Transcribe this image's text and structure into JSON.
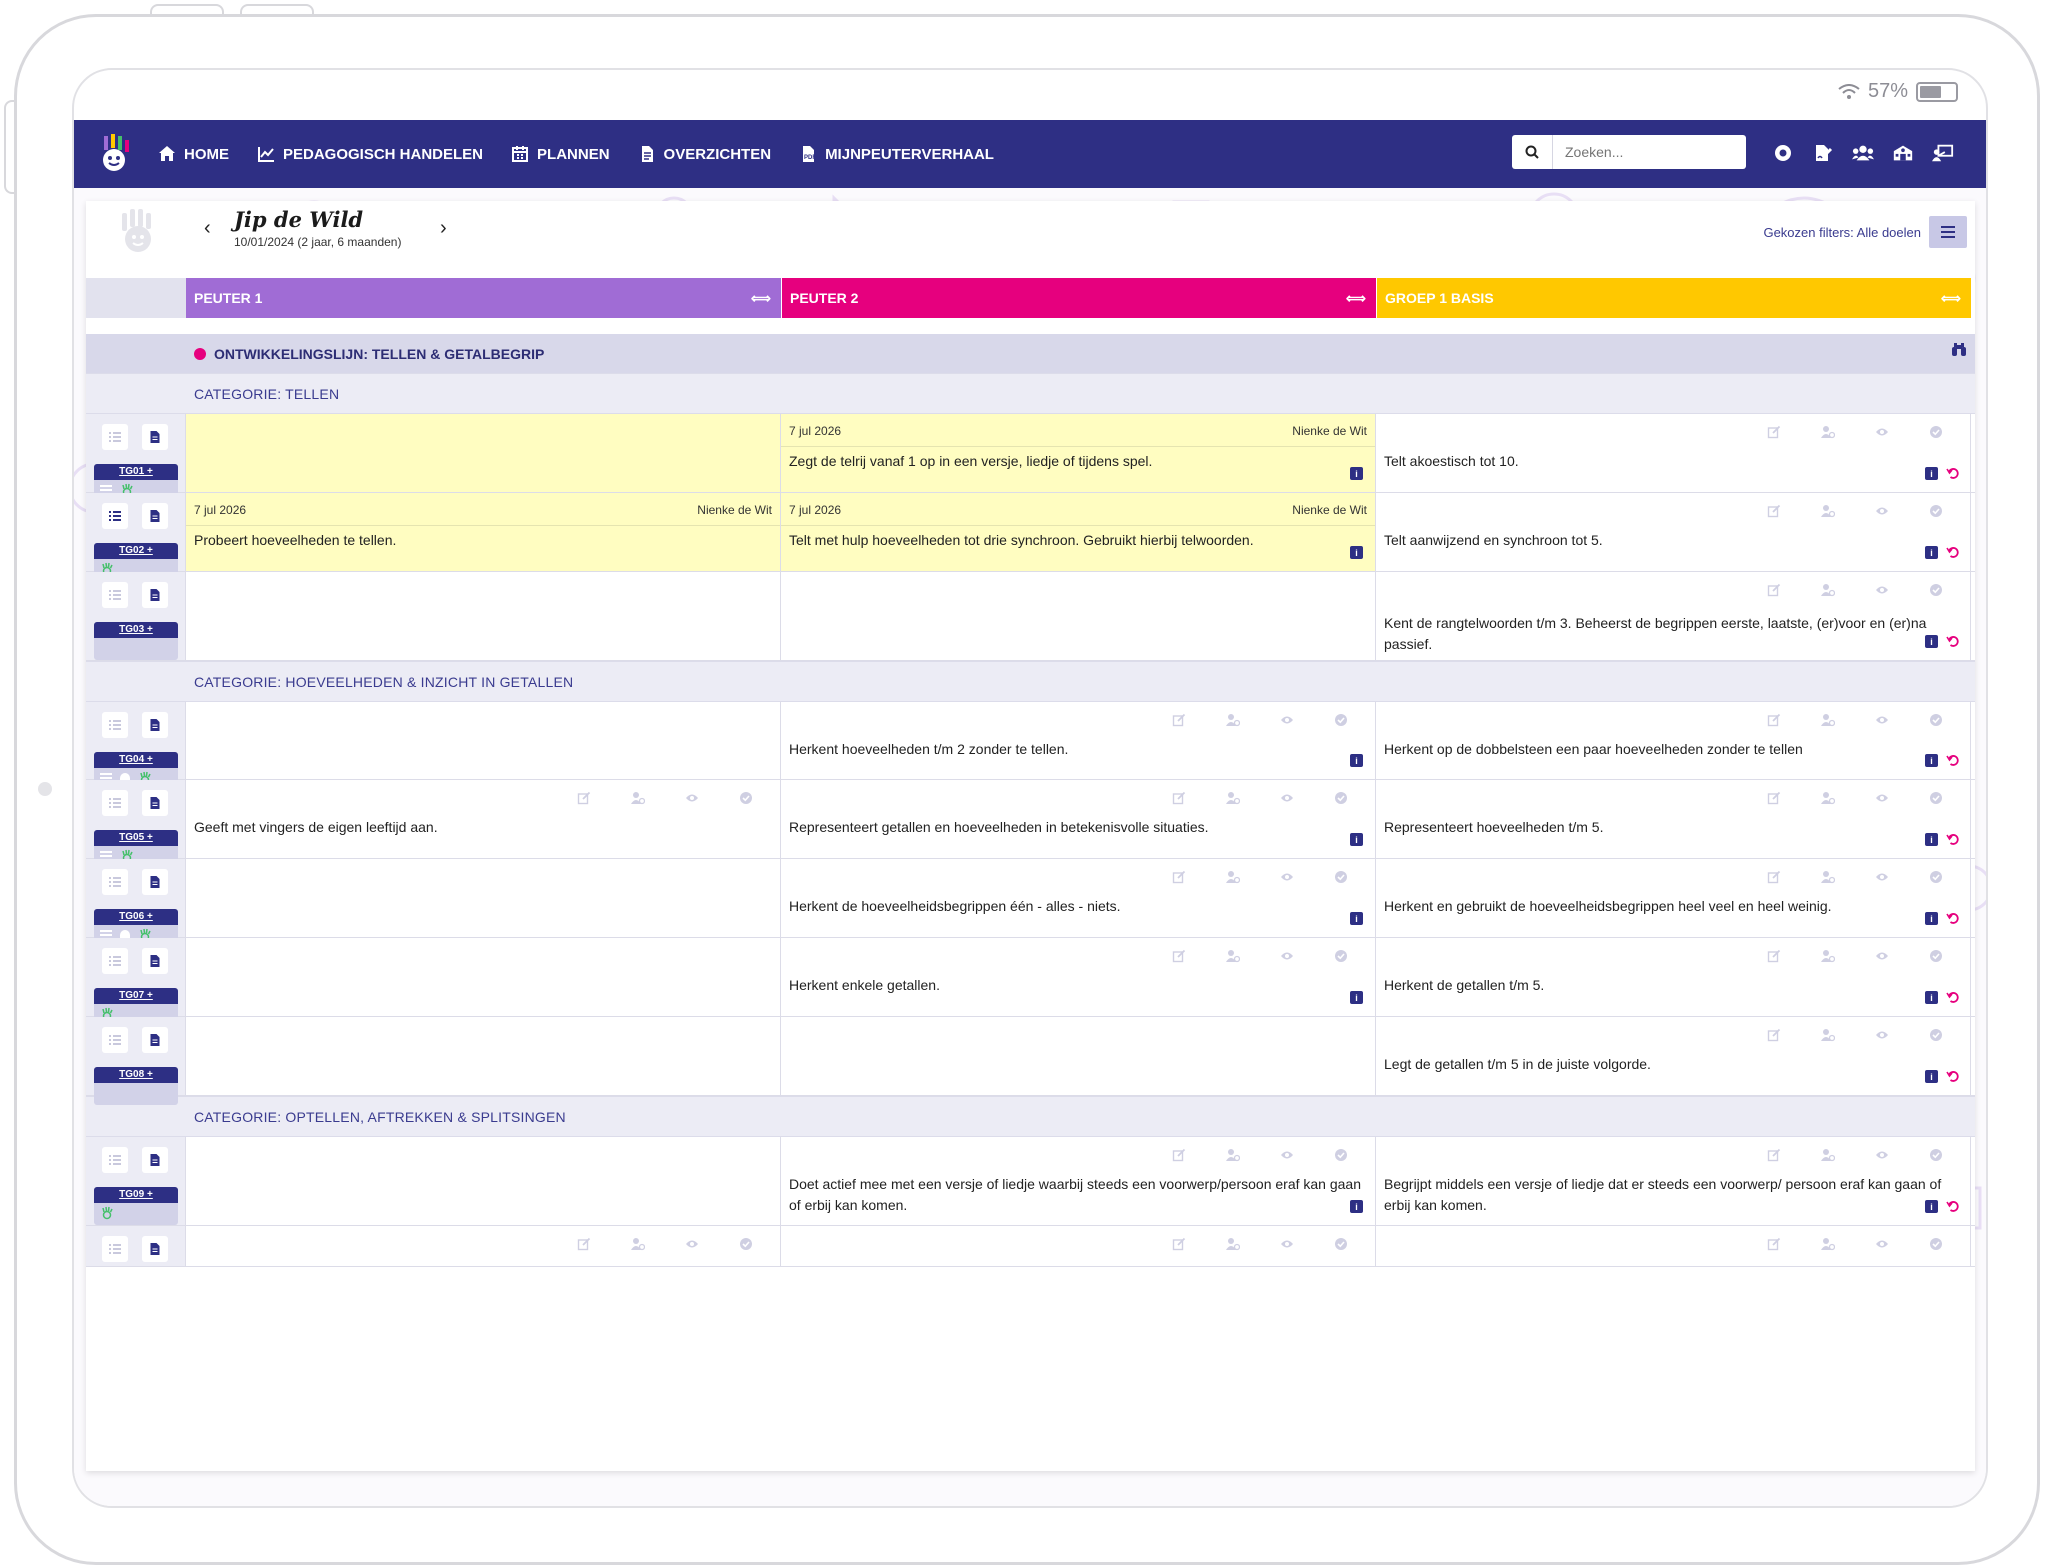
{
  "status": {
    "battery": "57%"
  },
  "nav": {
    "items": [
      {
        "label": "HOME",
        "icon": "home-icon"
      },
      {
        "label": "PEDAGOGISCH HANDELEN",
        "icon": "chart-line-icon"
      },
      {
        "label": "PLANNEN",
        "icon": "calendar-icon"
      },
      {
        "label": "OVERZICHTEN",
        "icon": "document-icon"
      },
      {
        "label": "MIJNPEUTERVERHAAL",
        "icon": "pdf-icon"
      }
    ],
    "search_placeholder": "Zoeken...",
    "right_icons": [
      "record-icon",
      "file-signature-icon",
      "users-icon",
      "school-icon",
      "teacher-icon"
    ]
  },
  "child": {
    "name": "Jip de Wild",
    "dob": "10/01/2024 (2 jaar, 6 maanden)",
    "filters_label": "Gekozen filters: Alle doelen"
  },
  "columns": [
    {
      "label": "PEUTER 1",
      "color": "#a06cd5"
    },
    {
      "label": "PEUTER 2",
      "color": "#e6007e"
    },
    {
      "label": "GROEP 1 BASIS",
      "color": "#ffc800"
    }
  ],
  "lijn": {
    "label": "ONTWIKKELINGSLIJN: TELLEN & GETALBEGRIP",
    "dot_color": "#e6007e"
  },
  "categories": [
    "CATEGORIE: TELLEN",
    "CATEGORIE: HOEVEELHEDEN & INZICHT IN GETALLEN",
    "CATEGORIE: OPTELLEN, AFTREKKEN & SPLITSINGEN"
  ],
  "rows": [
    {
      "code": "TG01 +",
      "cells": [
        {
          "text": "",
          "yellow": true
        },
        {
          "text": "Zegt de telrij vanaf 1 op in een versje, liedje of tijdens spel.",
          "date": "7 jul 2026",
          "author": "Nienke de Wit",
          "yellow": true
        },
        {
          "text": "Telt akoestisch tot 10."
        }
      ]
    },
    {
      "code": "TG02 +",
      "cells": [
        {
          "text": "Probeert hoeveelheden te tellen.",
          "date": "7 jul 2026",
          "author": "Nienke de Wit",
          "yellow": true
        },
        {
          "text": "Telt met hulp hoeveelheden tot drie synchroon. Gebruikt hierbij telwoorden.",
          "date": "7 jul 2026",
          "author": "Nienke de Wit",
          "yellow": true
        },
        {
          "text": "Telt aanwijzend en synchroon tot 5."
        }
      ]
    },
    {
      "code": "TG03 +",
      "cells": [
        {
          "text": ""
        },
        {
          "text": ""
        },
        {
          "text": "Kent de rangtelwoorden t/m 3. Beheerst de begrippen eerste, laatste, (er)voor en (er)na passief."
        }
      ]
    },
    {
      "code": "TG04 +",
      "cells": [
        {
          "text": ""
        },
        {
          "text": "Herkent hoeveelheden t/m 2 zonder te tellen."
        },
        {
          "text": "Herkent op de dobbelsteen een paar hoeveelheden zonder te tellen"
        }
      ]
    },
    {
      "code": "TG05 +",
      "cells": [
        {
          "text": "Geeft met vingers de eigen leeftijd aan."
        },
        {
          "text": "Representeert getallen en hoeveelheden in betekenisvolle situaties."
        },
        {
          "text": "Representeert hoeveelheden t/m 5."
        }
      ]
    },
    {
      "code": "TG06 +",
      "cells": [
        {
          "text": ""
        },
        {
          "text": "Herkent de hoeveelheidsbegrippen één - alles - niets."
        },
        {
          "text": "Herkent en gebruikt de hoeveelheidsbegrippen heel veel en heel weinig."
        }
      ]
    },
    {
      "code": "TG07 +",
      "cells": [
        {
          "text": ""
        },
        {
          "text": "Herkent enkele getallen."
        },
        {
          "text": "Herkent de getallen t/m 5."
        }
      ]
    },
    {
      "code": "TG08 +",
      "cells": [
        {
          "text": ""
        },
        {
          "text": ""
        },
        {
          "text": "Legt de getallen t/m 5 in de juiste volgorde."
        }
      ]
    },
    {
      "code": "TG09 +",
      "cells": [
        {
          "text": ""
        },
        {
          "text": "Doet actief mee met een versje of liedje waarbij steeds een voorwerp/persoon eraf kan gaan of erbij kan komen."
        },
        {
          "text": "Begrijpt middels een versje of liedje dat er steeds een voorwerp/ persoon eraf kan gaan of erbij kan komen."
        }
      ]
    }
  ]
}
